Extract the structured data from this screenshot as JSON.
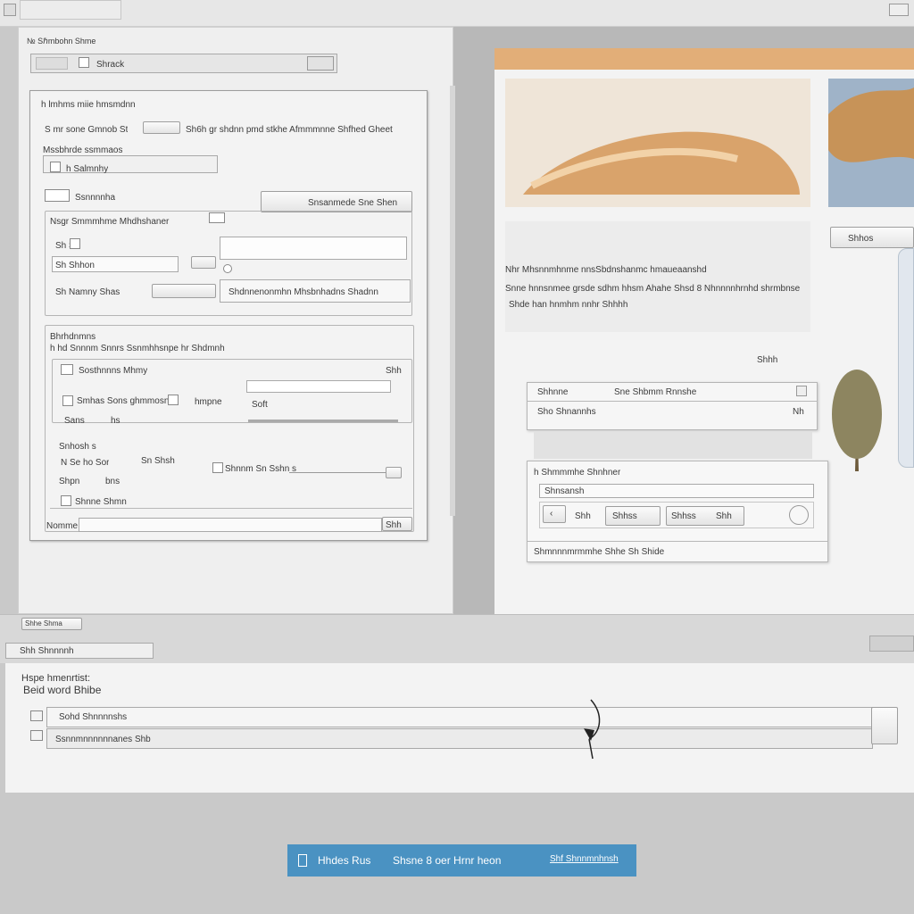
{
  "colors": {
    "accent_bar": "#4a92c2",
    "photo_header": "#e2ae78",
    "page_bg": "#c9c9c9"
  },
  "left_panel": {
    "header_label": "№ Sℏmbohn Shme",
    "address_value": "Shrack",
    "dialog": {
      "title": "h lmhms miie hmsmdnn",
      "row1": "S mr sone Gmnob St",
      "row1_right": "Sh6h gr shdnn pmd stkhe Afmmmnne Shfhed Gheet",
      "section1": "Mssbhrde ssmmaos",
      "opt1": "h Salmnhy",
      "opt2": "Ssnnnnha",
      "action_button": "Snsanmede Sne Shen",
      "group_label": "Nsgr Smmmhme Mhdhshaner",
      "item1": "Sh Sh",
      "item2": "Sh Shhon",
      "item3": "Sh Namny Shas",
      "item3_right": "Shdnnenonmhn Mhsbnhadns Shadnn",
      "frame_title": "Bhrhdnmns",
      "frame_sub": "h hd Snnnm Snnrs Ssnmhhsnpe hr Shdmnh",
      "lbl_a": "Sosthnnns Mhmy",
      "lbl_a_right": "Shh",
      "lbl_b": "Smhas Sons ghmmosn",
      "lbl_b_right": "hmpne",
      "lbl_c": "Sans",
      "lbl_c_val": "hs",
      "lbl_c_tail": "Soft",
      "lbl_d": "Snhosh s",
      "lbl_e": "N Se ho Sor",
      "lbl_e_mid": "Sn Shsh",
      "lbl_e_right": "Shnnm Sn Sshn s",
      "lbl_f": "Shpn",
      "lbl_f_mid": "bns",
      "lbl_g": "Shnne Shmn",
      "footer_label": "Nomme",
      "footer_btn": "Shh"
    }
  },
  "right_panel": {
    "right_tab": "Shhos",
    "text_line1": "Nhr Mhsnnmhnme nnsSbdnshanmc hmaueaanshd",
    "text_line2": "Snne hnnsnmee grsde sdhm hhsm Ahahe Shsd 8 Nhnnnnhrnhd shrmbnse",
    "text_line3": "Shde han hnmhm nnhr Shhhh",
    "text_right": "Shhh",
    "popup1": {
      "title_left": "Shhnne",
      "title_right": "Sne Shbmm Rnnshe",
      "row_text": "Sho Shnannhs",
      "row_right": "Nh"
    },
    "popup2": {
      "label": "h Shmmmhe Shnhner",
      "field_value": "Shnsansh",
      "btn1": "Shh",
      "btn2": "Shhss",
      "btn3": "Shhss",
      "btn4": "Shh",
      "footer": "Shmnnnmrmmhe Shhe Sh Shide"
    }
  },
  "tab_strip": {
    "tab1": "Shhe Shma",
    "tab2": "Shh Shnnnnh"
  },
  "bottom_panel": {
    "heading": "Hspe hmenrtist:",
    "subheading": "Beid word Bhibe",
    "row1": "Sohd Shnnnnshs",
    "row2": "Ssnnmnnnnnnanes Shb"
  },
  "accent_bar": {
    "left": "Hhdes Rus",
    "center": "Shsne 8 oer Hrnr heon",
    "right": "Shf Shnnmnhnsh"
  }
}
